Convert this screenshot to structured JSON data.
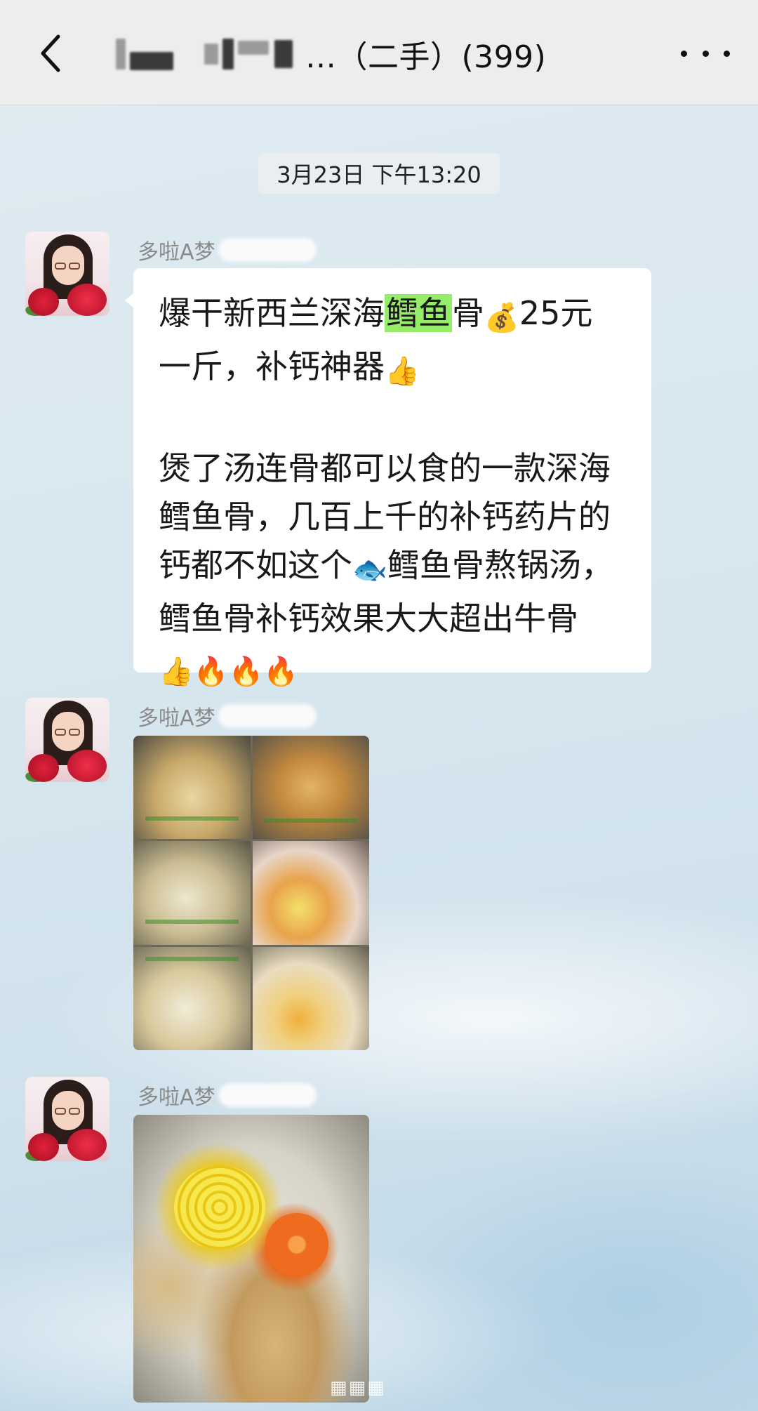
{
  "header": {
    "title": "…（二手）(399)",
    "back_icon": "chevron-left-icon",
    "more_icon": "more-dots-icon"
  },
  "chat": {
    "timestamp": "3月23日 下午13:20",
    "messages": [
      {
        "sender": "多啦A梦",
        "type": "text",
        "lines_p1": [
          "爆干新西兰深海",
          "鳕鱼",
          "骨",
          "💰",
          "25元",
          "一斤，补钙神器",
          "👍"
        ],
        "p2": "煲了汤连骨都可以食的一款深海鳕鱼骨，几百上千的补钙药片的钙都不如这个",
        "p2_emoji": "🐟",
        "p3": "鳕鱼骨熬锅汤，鳕鱼骨补钙效果大大超出牛骨",
        "p3_emojis": "👍🔥🔥🔥"
      },
      {
        "sender": "多啦A梦",
        "type": "image",
        "image_desc": "food-collage-image"
      },
      {
        "sender": "多啦A梦",
        "type": "image",
        "image_desc": "soup-image"
      }
    ]
  },
  "colors": {
    "header_bg": "#ededed",
    "highlight": "#95ec69",
    "bubble_bg": "#ffffff"
  }
}
